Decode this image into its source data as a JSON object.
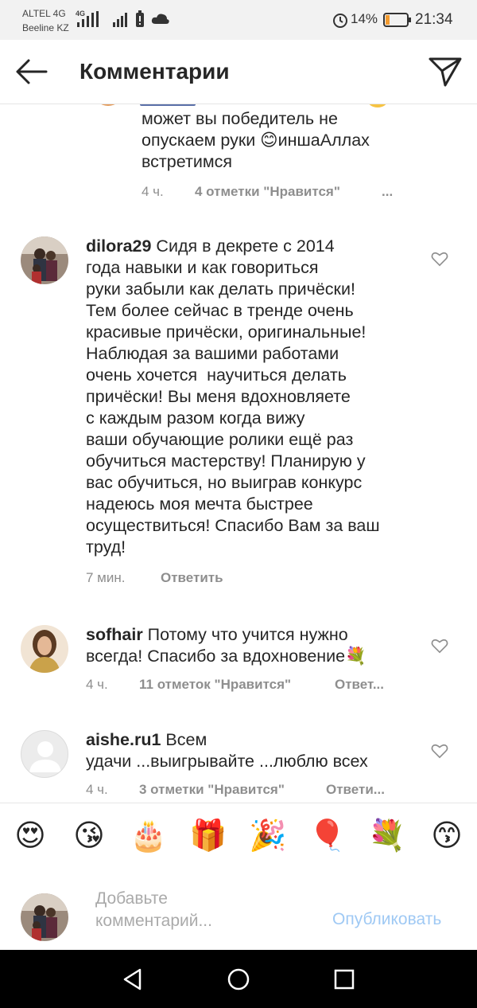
{
  "status_bar": {
    "carrier1": "ALTEL 4G",
    "carrier2": "Beeline KZ",
    "network_tag": "4G",
    "battery": "14%",
    "time": "21:34"
  },
  "header": {
    "title": "Комментарии"
  },
  "comments": [
    {
      "user": "",
      "lines": [
        "может вы победитель не",
        "опускаем руки 😊иншаАллах",
        "встретимся"
      ],
      "time": "4 ч.",
      "likes": "4 отметки \"Нравится\"",
      "more": "..."
    },
    {
      "user": "dilora29",
      "first_line": " Сидя в декрете с 2014",
      "lines": [
        "года навыки и как говориться",
        "руки забыли как делать причёски!",
        "Тем более сейчас в тренде очень",
        "красивые причёски, оригинальные!",
        "Наблюдая за вашими работами",
        "очень хочется  научиться делать",
        "причёски! Вы меня вдохновляете",
        "с каждым разом когда вижу",
        "ваши обучающие ролики ещё раз",
        "обучиться мастерству! Планирую у",
        "вас обучиться, но выиграв конкурс",
        "надеюсь моя мечта быстрее",
        "осуществиться! Спасибо Вам за ваш",
        "труд!"
      ],
      "time": "7 мин.",
      "reply": "Ответить"
    },
    {
      "user": "sofhair",
      "first_line": " Потому что учится нужно",
      "lines": [
        "всегда! Спасибо за вдохновение💐"
      ],
      "time": "4 ч.",
      "likes": "11 отметок \"Нравится\"",
      "reply": "Ответ..."
    },
    {
      "user": "aishe.ru1",
      "first_line": " Всем",
      "lines": [
        "удачи ...выигрывайте ...люблю всех"
      ],
      "time": "4 ч.",
      "likes": "3 отметки \"Нравится\"",
      "reply": "Ответи..."
    }
  ],
  "emoji_bar": [
    "😍",
    "😘",
    "🎂",
    "🎁",
    "🎉",
    "🎈",
    "💐",
    "😙"
  ],
  "composer": {
    "placeholder": "Добавьте\nкомментарий...",
    "publish": "Опубликовать"
  },
  "icons": {
    "back": "back-arrow-icon",
    "direct": "paper-plane-icon",
    "heart": "heart-outline-icon",
    "nav": [
      "nav-back-icon",
      "nav-home-icon",
      "nav-recents-icon"
    ]
  }
}
